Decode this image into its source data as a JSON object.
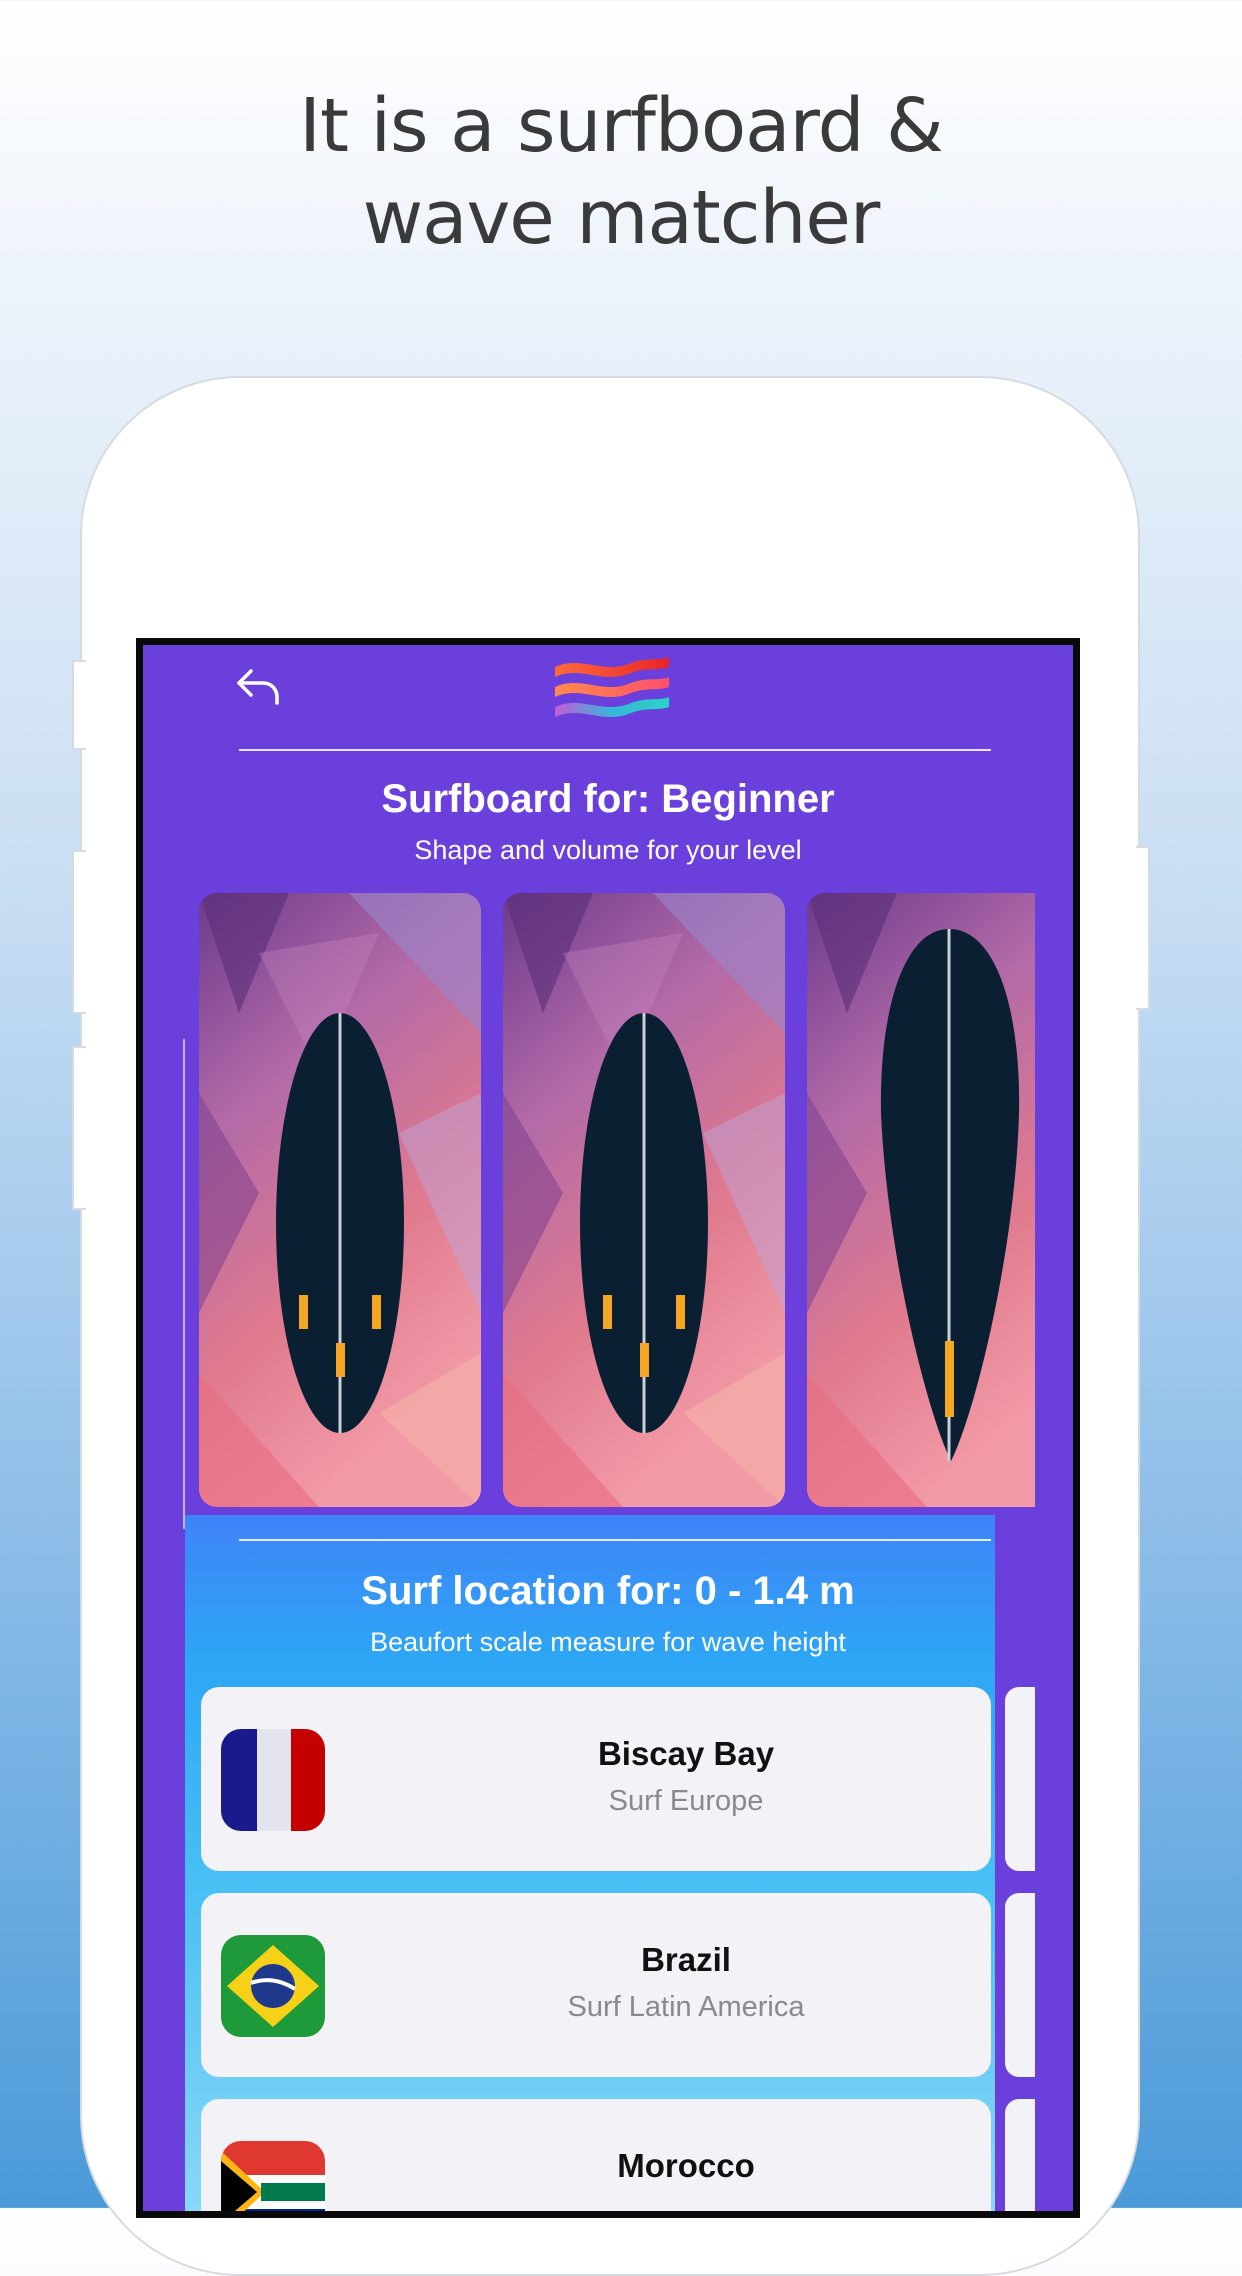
{
  "headline": {
    "line1": "It is a surfboard &",
    "line2": "wave matcher"
  },
  "app": {
    "back_icon": "back-arrow-icon",
    "logo_icon": "wave-logo-icon",
    "surfboard_section": {
      "title": "Surfboard for: Beginner",
      "subtitle": "Shape and volume for your level"
    },
    "boards": [
      {
        "name": "funboard-board"
      },
      {
        "name": "egg-board"
      },
      {
        "name": "longboard-board"
      }
    ],
    "location_section": {
      "title": "Surf location for: 0 - 1.4 m",
      "subtitle": "Beaufort scale measure for wave height"
    },
    "locations": [
      {
        "name": "Biscay Bay",
        "region": "Surf Europe",
        "flag": "france-flag-icon"
      },
      {
        "name": "Brazil",
        "region": "Surf Latin America",
        "flag": "brazil-flag-icon"
      },
      {
        "name": "Morocco",
        "region": "",
        "flag": "south-africa-flag-icon"
      }
    ],
    "colors": {
      "primary_purple": "#6a3fdc",
      "board_navy": "#0b1f33",
      "fin_orange": "#f5a623"
    }
  }
}
